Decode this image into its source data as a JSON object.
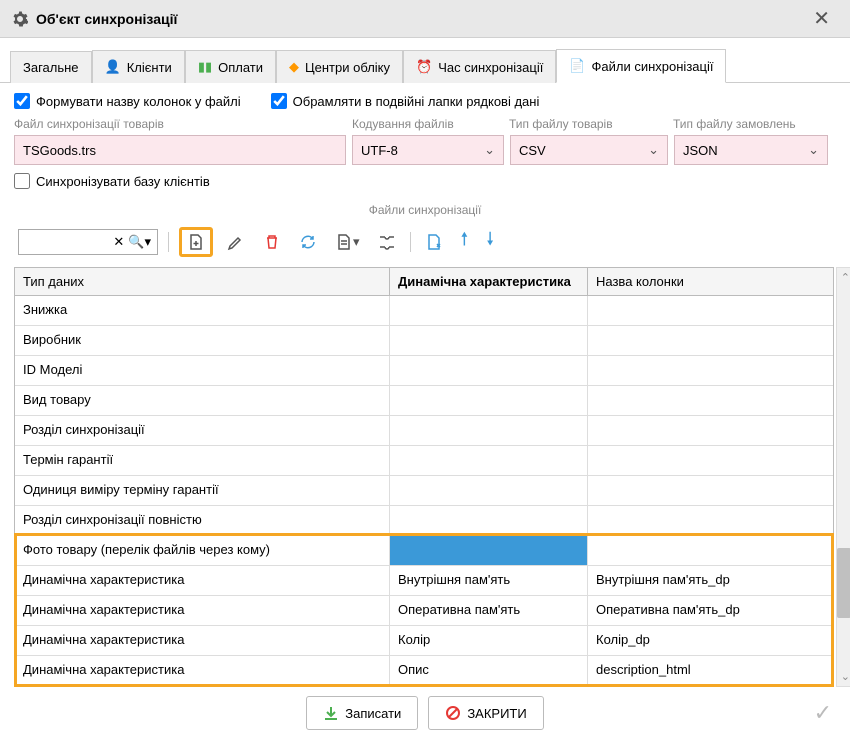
{
  "title": "Об'єкт синхронізації",
  "tabs": [
    "Загальне",
    "Клієнти",
    "Оплати",
    "Центри обліку",
    "Час синхронізації",
    "Файли синхронізації"
  ],
  "checkbox1": "Формувати назву колонок у файлі",
  "checkbox2": "Обрамляти в подвійні лапки рядкові дані",
  "checkbox3": "Синхронізувати базу клієнтів",
  "labels": {
    "file_sync": "Файл синхронізації товарів",
    "encoding": "Кодування файлів",
    "goods_type": "Тип файлу товарів",
    "orders_type": "Тип файлу замовлень"
  },
  "fields": {
    "file": "TSGoods.trs",
    "encoding": "UTF-8",
    "goods_type": "CSV",
    "orders_type": "JSON"
  },
  "section_label": "Файли синхронізації",
  "grid_headers": [
    "Тип даних",
    "Динамічна характеристика",
    "Назва колонки"
  ],
  "rows": [
    {
      "c1": "Знижка",
      "c2": "",
      "c3": ""
    },
    {
      "c1": "Виробник",
      "c2": "",
      "c3": ""
    },
    {
      "c1": "ID Моделі",
      "c2": "",
      "c3": ""
    },
    {
      "c1": "Вид товару",
      "c2": "",
      "c3": ""
    },
    {
      "c1": "Розділ синхронізації",
      "c2": "",
      "c3": ""
    },
    {
      "c1": "Термін гарантії",
      "c2": "",
      "c3": ""
    },
    {
      "c1": "Одиниця виміру терміну гарантії",
      "c2": "",
      "c3": ""
    },
    {
      "c1": "Розділ синхронізації повністю",
      "c2": "",
      "c3": ""
    },
    {
      "c1": "Фото товару (перелік файлів через кому)",
      "c2": "",
      "c3": "",
      "sel": true
    },
    {
      "c1": "Динамічна характеристика",
      "c2": "Внутрішня пам'ять",
      "c3": "Внутрішня пам'ять_dp"
    },
    {
      "c1": "Динамічна характеристика",
      "c2": "Оперативна пам'ять",
      "c3": "Оперативна пам'ять_dp"
    },
    {
      "c1": "Динамічна характеристика",
      "c2": "Колір",
      "c3": "Колір_dp"
    },
    {
      "c1": "Динамічна характеристика",
      "c2": "Опис",
      "c3": "description_html"
    }
  ],
  "buttons": {
    "save": "Записати",
    "close": "ЗАКРИТИ"
  }
}
